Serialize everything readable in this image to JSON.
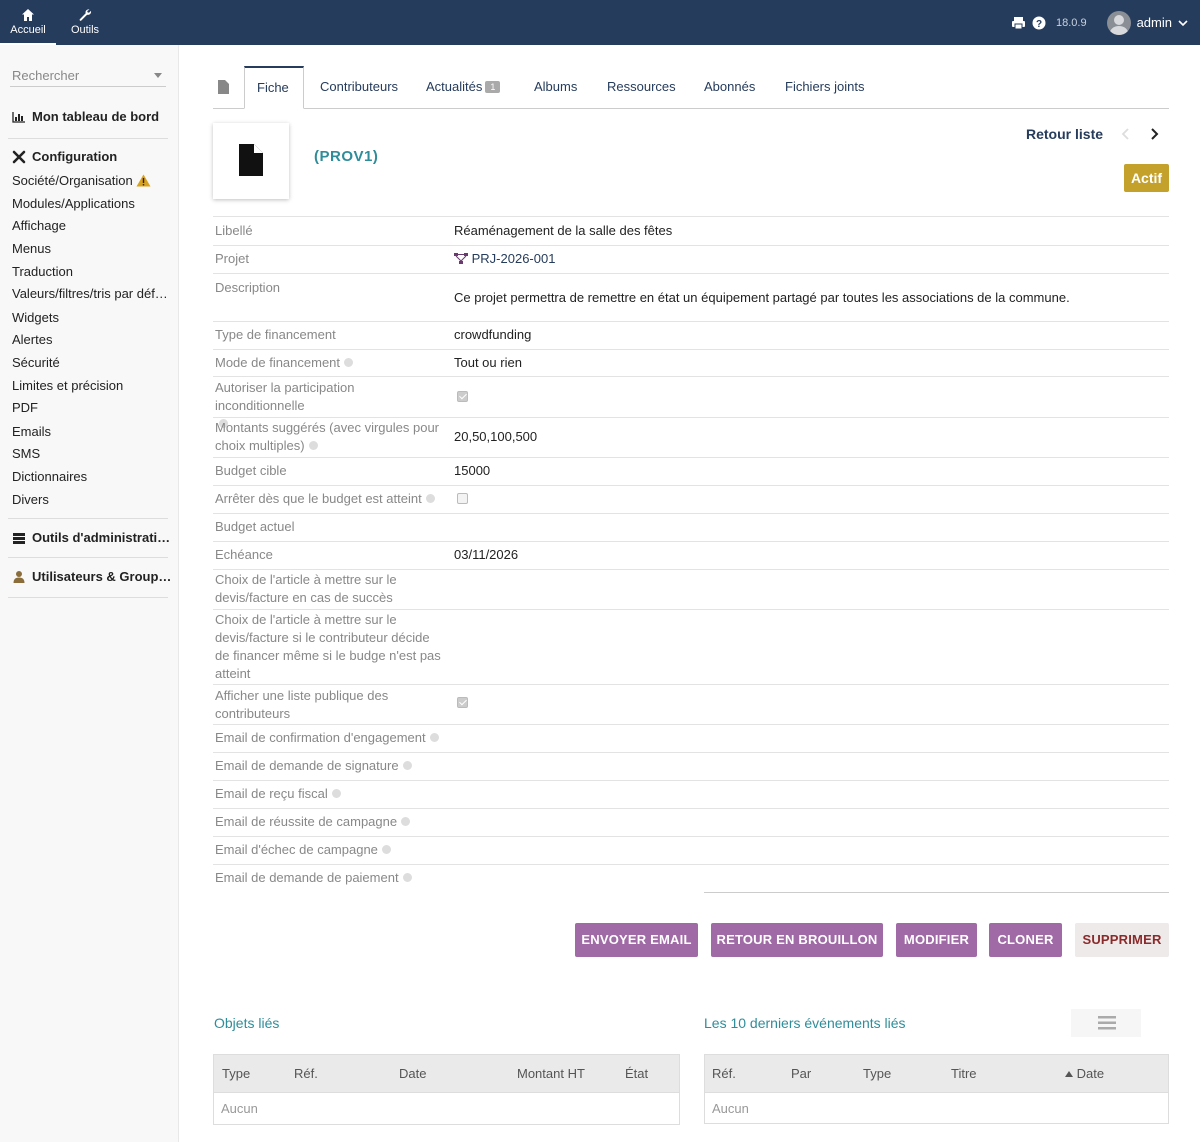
{
  "topbar": {
    "nav": [
      {
        "label": "Accueil",
        "icon": "home-icon"
      },
      {
        "label": "Outils",
        "icon": "wrench-icon"
      }
    ],
    "version": "18.0.9",
    "user": "admin"
  },
  "sidebar": {
    "search_placeholder": "Rechercher",
    "dashboard": "Mon tableau de bord",
    "config_title": "Configuration",
    "config_items": [
      "Société/Organisation",
      "Modules/Applications",
      "Affichage",
      "Menus",
      "Traduction",
      "Valeurs/filtres/tris par déf…",
      "Widgets",
      "Alertes",
      "Sécurité",
      "Limites et précision",
      "PDF",
      "Emails",
      "SMS",
      "Dictionnaires",
      "Divers"
    ],
    "admin_tools": "Outils d'administrati…",
    "users_groups": "Utilisateurs & Group…"
  },
  "tabs": [
    {
      "label": "Fiche"
    },
    {
      "label": "Contributeurs"
    },
    {
      "label": "Actualités",
      "badge": "1"
    },
    {
      "label": "Albums"
    },
    {
      "label": "Ressources"
    },
    {
      "label": "Abonnés"
    },
    {
      "label": "Fichiers joints"
    }
  ],
  "header": {
    "ref": "(PROV1)",
    "back_list": "Retour liste",
    "status": "Actif"
  },
  "fields": {
    "libelle": {
      "label": "Libellé",
      "value": "Réaménagement de la salle des fêtes"
    },
    "projet": {
      "label": "Projet",
      "value": "PRJ-2026-001"
    },
    "description": {
      "label": "Description",
      "value": "Ce projet permettra de remettre en état un équipement partagé par toutes les associations de la commune."
    },
    "type_financement": {
      "label": "Type de financement",
      "value": "crowdfunding"
    },
    "mode_financement": {
      "label": "Mode de financement",
      "value": "Tout ou rien"
    },
    "autoriser": {
      "label": "Autoriser la participation inconditionnelle",
      "checked": true
    },
    "montants": {
      "label": "Montants suggérés (avec virgules pour choix multiples)",
      "value": "20,50,100,500"
    },
    "budget_cible": {
      "label": "Budget cible",
      "value": "15000"
    },
    "arreter": {
      "label": "Arrêter dès que le budget est atteint",
      "checked": false
    },
    "budget_actuel": {
      "label": "Budget actuel",
      "value": ""
    },
    "echeance": {
      "label": "Echéance",
      "value": "03/11/2026"
    },
    "article_succes": {
      "label": "Choix de l'article à mettre sur le devis/facture en cas de succès",
      "value": ""
    },
    "article_echec": {
      "label": "Choix de l'article à mettre sur le devis/facture si le contributeur décide de financer même si le budge n'est pas atteint",
      "value": ""
    },
    "liste_publique": {
      "label": "Afficher une liste publique des contributeurs",
      "checked": true
    },
    "email_engagement": {
      "label": "Email de confirmation d'engagement"
    },
    "email_signature": {
      "label": "Email de demande de signature"
    },
    "email_recu": {
      "label": "Email de reçu fiscal"
    },
    "email_reussite": {
      "label": "Email de réussite de campagne"
    },
    "email_echec": {
      "label": "Email d'échec de campagne"
    },
    "email_paiement": {
      "label": "Email de demande de paiement"
    }
  },
  "actions": {
    "send_email": "ENVOYER EMAIL",
    "back_draft": "RETOUR EN BROUILLON",
    "modify": "MODIFIER",
    "clone": "CLONER",
    "delete": "SUPPRIMER"
  },
  "linked_objects": {
    "title": "Objets liés",
    "columns": [
      "Type",
      "Réf.",
      "Date",
      "Montant HT",
      "État"
    ],
    "empty": "Aucun"
  },
  "events": {
    "title": "Les 10 derniers événements liés",
    "columns": [
      "Réf.",
      "Par",
      "Type",
      "Titre",
      "Date"
    ],
    "empty": "Aucun"
  },
  "colors": {
    "topbar": "#263c5c",
    "accent": "#2f8d9a",
    "button": "#a06aa6",
    "status": "#c4a12a"
  }
}
